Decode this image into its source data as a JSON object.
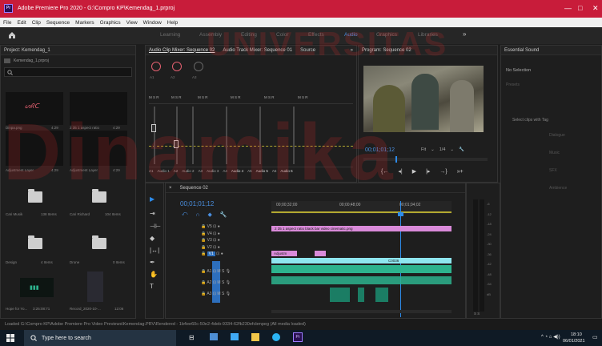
{
  "titlebar": {
    "title": "Adobe Premiere Pro 2020 - G:\\Compro KP\\Kemendag_1.prproj",
    "logo": "Pr",
    "min": "—",
    "max": "□",
    "close": "✕"
  },
  "menu": [
    "File",
    "Edit",
    "Clip",
    "Sequence",
    "Markers",
    "Graphics",
    "View",
    "Window",
    "Help"
  ],
  "workspaces": [
    "Learning",
    "Assembly",
    "Editing",
    "Color",
    "Effects",
    "Audio",
    "Graphics",
    "Libraries"
  ],
  "workspace_more": "»",
  "project": {
    "title": "Project: Kemendag_1",
    "file": "Kemendag_1.prproj",
    "items": [
      {
        "name": "Dinpa.png",
        "dur": "4:29"
      },
      {
        "name": "2 35 1 aspect ratio",
        "dur": "4:29"
      },
      {
        "name": "Adjustment Layer",
        "dur": "4:29"
      },
      {
        "name": "Adjustment Layer",
        "dur": "4:29"
      },
      {
        "name": "Cari Musik",
        "dur": "138 Items"
      },
      {
        "name": "Cari Richard",
        "dur": "104 Items"
      },
      {
        "name": "Design",
        "dur": "4 Items"
      },
      {
        "name": "Drone",
        "dur": "0 Items"
      },
      {
        "name": "Hope for Yo...",
        "dur": "3:25:08:71"
      },
      {
        "name": "Record_2020-10-...",
        "dur": "12:06"
      }
    ]
  },
  "mixer": {
    "tabs": [
      "Audio Clip Mixer: Sequence 02",
      "Audio Track Mixer: Sequence 01",
      "Source"
    ],
    "more": "»",
    "channels": [
      "A1",
      "Audio 1",
      "A2",
      "Audio 2",
      "A3",
      "Audio 3",
      "A4",
      "Audio 4",
      "A5",
      "Audio 5",
      "A6",
      "Audio 6"
    ],
    "msr": "M S R",
    "ch_tags": [
      "A1",
      "A2",
      "A3",
      "A4",
      "A5",
      "A6"
    ]
  },
  "program": {
    "title": "Program: Sequence 02",
    "timecode": "00;01;01;12",
    "fit": "Fit",
    "res": "1/4"
  },
  "essential": {
    "title": "Essential Sound",
    "no_selection": "No Selection",
    "presets": "Presets",
    "hint": "Select clips with Tag",
    "types": [
      "Dialogue",
      "Music",
      "SFX",
      "Ambience"
    ]
  },
  "timeline": {
    "title": "Sequence 02",
    "timecode": "00;01;01;12",
    "ruler": [
      "00;00;32;00",
      "00;00;48;00",
      "00;01;04;02"
    ],
    "video_tracks": [
      "V5",
      "V4",
      "V3",
      "V2",
      "V1"
    ],
    "audio_tracks": [
      "A1",
      "A2",
      "A3"
    ],
    "clip_aspect": "2 35 1 aspect ratio black bar video cinematic.png",
    "clip_adj": "Adjustm",
    "clip_c0036": "C0036"
  },
  "meters": {
    "scale": [
      "-6",
      "-12",
      "-18",
      "-24",
      "-30",
      "-36",
      "-42",
      "-48",
      "-54",
      "dB"
    ],
    "sr": "S S"
  },
  "status": "Loaded G:\\Compro KP\\Adobe Premiere Pro Video Previews\\Kemendag.PRV\\Rendered - 1b4ee60c-50e2-4deb-9334-62fb230efcbmpeg (All media loaded)",
  "taskbar": {
    "search": "Type here to search",
    "time": "18:10",
    "date": "06/01/2021"
  },
  "watermark": {
    "word": "UNIVERSITAS",
    "word2": "Dinamika"
  },
  "colors": {
    "titlebar": "#c81c3a",
    "accent": "#2d8ceb",
    "clip_pink": "#d98ad9",
    "clip_cyan": "#8ee6ef",
    "audio_green": "#2db38e"
  }
}
